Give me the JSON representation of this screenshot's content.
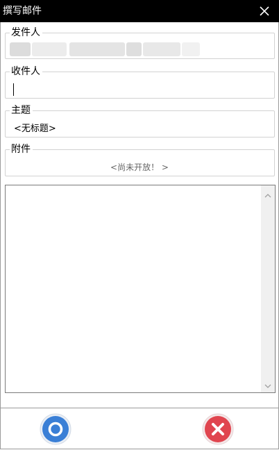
{
  "window": {
    "title": "撰写邮件"
  },
  "sender": {
    "label": "发件人"
  },
  "recipient": {
    "label": "收件人",
    "value": ""
  },
  "subject": {
    "label": "主题",
    "value": "<无标题>"
  },
  "attachment": {
    "label": "附件",
    "status": "<尚未开放！ >"
  },
  "body": {
    "value": ""
  },
  "buttons": {
    "confirm_icon": "circle-icon",
    "cancel_icon": "x-icon"
  },
  "colors": {
    "titlebar": "#000000",
    "confirm": "#3a7fd6",
    "cancel": "#e0454f"
  }
}
